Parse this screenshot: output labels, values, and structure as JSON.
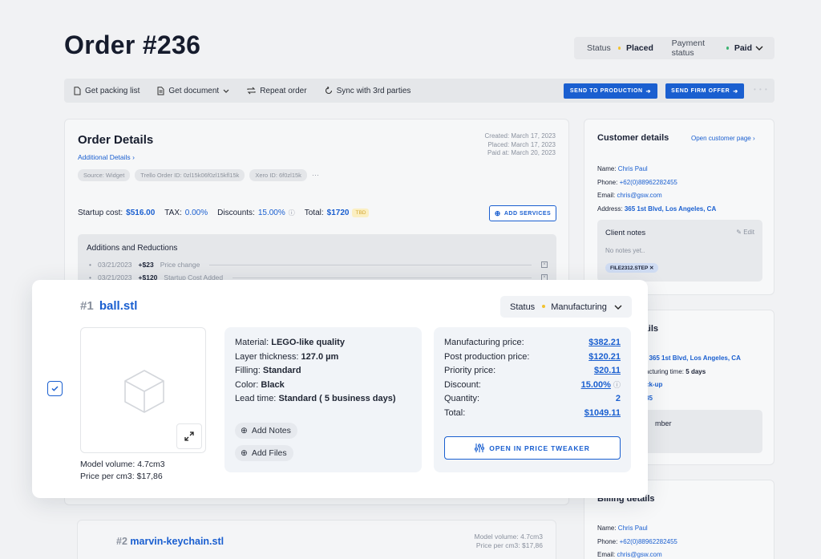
{
  "header": {
    "title": "Order #236",
    "status_label": "Status",
    "status_value": "Placed",
    "status_color": "#f2c230",
    "payment_label": "Payment status",
    "payment_value": "Paid",
    "payment_color": "#3cb371"
  },
  "toolbar": {
    "packing": "Get packing list",
    "document": "Get document",
    "repeat": "Repeat order",
    "sync": "Sync with 3rd parties",
    "send_production": "SEND TO PRODUCTION",
    "send_offer": "SEND FIRM OFFER",
    "faded": "• • •"
  },
  "order_details": {
    "title": "Order Details",
    "additional": "Additional Details",
    "created": "Created: March 17, 2023",
    "placed": "Placed: March 17, 2023",
    "paid": "Paid at: March 20, 2023",
    "chips": [
      "Source: Widget",
      "Trello Order ID: 0zl15k06f0zl15kfl15k",
      "Xero ID: 6f0zl15k"
    ],
    "more": "···",
    "startup_label": "Startup cost:",
    "startup_value": "$516.00",
    "tax_label": "TAX:",
    "tax_value": "0.00%",
    "discounts_label": "Discounts:",
    "discounts_value": "15.00%",
    "total_label": "Total:",
    "total_value": "$1720",
    "tbd": "TBD",
    "add_services": "ADD SERVICES",
    "additions_title": "Additions and Reductions",
    "additions": [
      {
        "date": "03/21/2023",
        "amount": "+$23",
        "desc": "Price change"
      },
      {
        "date": "03/21/2023",
        "amount": "+$120",
        "desc": "Startup Cost Added"
      }
    ]
  },
  "customer": {
    "title": "Customer details",
    "open": "Open customer page",
    "name_label": "Name:",
    "name": "Chris Paul",
    "phone_label": "Phone:",
    "phone": "+62(0)88962282455",
    "email_label": "Email:",
    "email": "chris@gsw.com",
    "address_label": "Address:",
    "address": "365 1st Blvd, Los Angeles, CA",
    "notes_title": "Client notes",
    "edit": "Edit",
    "no_notes": "No notes yet..",
    "file_tag": "FILE2312.STEP"
  },
  "shipping": {
    "title_partial": "tails",
    "address_partial": "365 1st Blvd, Los Angeles, CA",
    "time_partial": "acturing time:",
    "time_value": "5 days",
    "pickup_partial": "ck-up",
    "num_partial": "85",
    "member_partial": "mber"
  },
  "billing": {
    "title": "Billing details",
    "name_label": "Name:",
    "name": "Chris Paul",
    "phone_label": "Phone:",
    "phone": "+62(0)88962282455",
    "email_label": "Email:",
    "email": "chris@gsw.com"
  },
  "item1": {
    "number": "#1",
    "filename": "ball.stl",
    "status_label": "Status",
    "status_value": "Manufacturing",
    "status_color": "#f2c230",
    "model_volume": "Model volume: 4.7cm3",
    "price_per": "Price per cm3: $17,86",
    "specs": [
      {
        "label": "Material:",
        "value": "LEGO-like quality"
      },
      {
        "label": "Layer thickness:",
        "value": "127.0 µm"
      },
      {
        "label": "Filling:",
        "value": "Standard"
      },
      {
        "label": "Color:",
        "value": "Black"
      },
      {
        "label": "Lead time:",
        "value": "Standard ( 5 business days)"
      }
    ],
    "add_notes": "Add Notes",
    "add_files": "Add Files",
    "prices": [
      {
        "label": "Manufacturing price:",
        "value": "$382.21"
      },
      {
        "label": "Post production price:",
        "value": "$120.21"
      },
      {
        "label": "Priority price:",
        "value": "$20.11"
      },
      {
        "label": "Discount:",
        "value": "15.00%"
      },
      {
        "label": "Quantity:",
        "value": "2"
      },
      {
        "label": "Total:",
        "value": "$1049.11"
      }
    ],
    "tweaker": "OPEN IN PRICE TWEAKER"
  },
  "item2": {
    "number": "#2",
    "filename": "marvin-keychain.stl",
    "model_volume": "Model volume: 4.7cm3",
    "price_per": "Price per cm3: $17,86"
  }
}
